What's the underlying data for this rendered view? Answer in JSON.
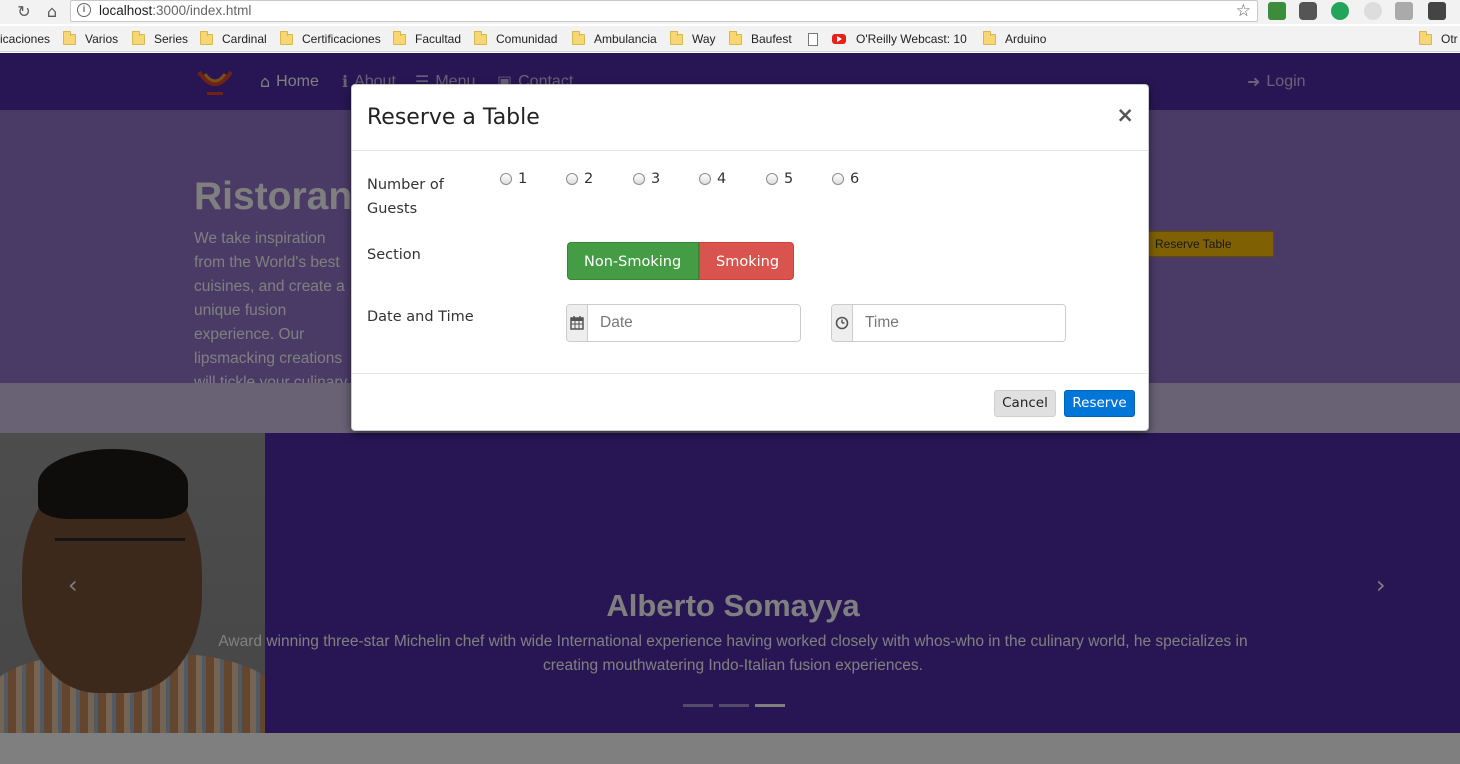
{
  "browser": {
    "url_host": "localhost",
    "url_path": ":3000/index.html",
    "bookmarks": [
      "icaciones",
      "Varios",
      "Series",
      "Cardinal",
      "Certificaciones",
      "Facultad",
      "Comunidad",
      "Ambulancia",
      "Way",
      "Baufest",
      "",
      "O'Reilly Webcast: 10",
      "Arduino",
      "Otr"
    ]
  },
  "navbar": {
    "home": "Home",
    "about": "About",
    "menu": "Menu",
    "contact": "Contact",
    "login": "Login"
  },
  "jumbotron": {
    "title": "Ristorante",
    "text": "We take inspiration from the World's best cuisines, and create a unique fusion experience. Our lipsmacking creations will tickle your culinary senses!",
    "button": "Reserve Table"
  },
  "carousel": {
    "title": "Alberto Somayya",
    "description": "Award winning three-star Michelin chef with wide International experience having worked closely with whos-who in the culinary world, he specializes in creating mouthwatering Indo-Italian fusion experiences."
  },
  "modal": {
    "title": "Reserve a Table",
    "close": "×",
    "guests_label": "Number of Guests",
    "guest_options": [
      "1",
      "2",
      "3",
      "4",
      "5",
      "6"
    ],
    "section_label": "Section",
    "non_smoking": "Non-Smoking",
    "smoking": "Smoking",
    "datetime_label": "Date and Time",
    "date_placeholder": "Date",
    "time_placeholder": "Time",
    "cancel": "Cancel",
    "reserve": "Reserve"
  },
  "colors": {
    "navbar": "#512da8",
    "jumbotron": "#9575cd",
    "non_smoking": "#449d44",
    "smoking": "#d9534f",
    "reserve_button": "#0275d8"
  }
}
